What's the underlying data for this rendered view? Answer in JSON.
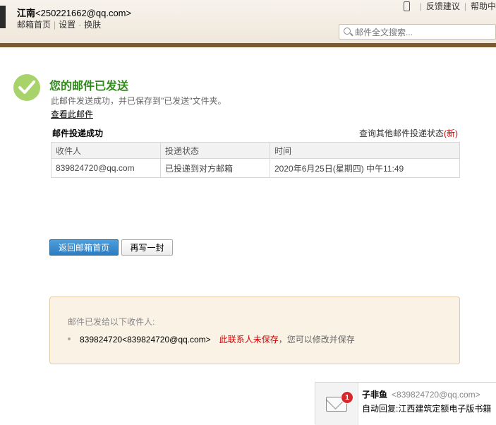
{
  "header": {
    "user_name": "江南",
    "user_email": "<250221662@qq.com>",
    "nav": [
      "邮箱首页",
      "设置",
      "换肤"
    ],
    "nav_sep_bar": "|",
    "nav_sep_dash": "-",
    "feedback": "反馈建议",
    "help": "帮助中",
    "search_placeholder": "邮件全文搜索..."
  },
  "result": {
    "title": "您的邮件已发送",
    "description": "此邮件发送成功，并已保存到\"已发送\"文件夹。",
    "view_link": "查看此邮件",
    "delivery_label": "邮件投递成功",
    "query_link": "查询其他邮件投递状态",
    "query_new": "(新)"
  },
  "table": {
    "headers": [
      "收件人",
      "投递状态",
      "时间"
    ],
    "rows": [
      [
        "839824720@qq.com",
        "已投递到对方邮箱",
        "2020年6月25日(星期四) 中午11:49"
      ]
    ]
  },
  "buttons": {
    "back": "返回邮箱首页",
    "rewrite": "再写一封"
  },
  "notice": {
    "title": "邮件已发给以下收件人:",
    "contact": "839824720<839824720@qq.com>",
    "warning": "此联系人未保存",
    "tip": "，您可以修改并保存"
  },
  "popup": {
    "badge_count": "1",
    "sender_name": "子非鱼",
    "sender_email": "<839824720@qq.com>",
    "subject": "自动回复:江西建筑定额电子版书籍"
  },
  "colors": {
    "accent_green": "#2f8a1a",
    "check_green": "#a7d36a",
    "primary_blue": "#2d7cc1",
    "warning_red": "#cc0000",
    "header_stripe": "#7a5a2e"
  }
}
